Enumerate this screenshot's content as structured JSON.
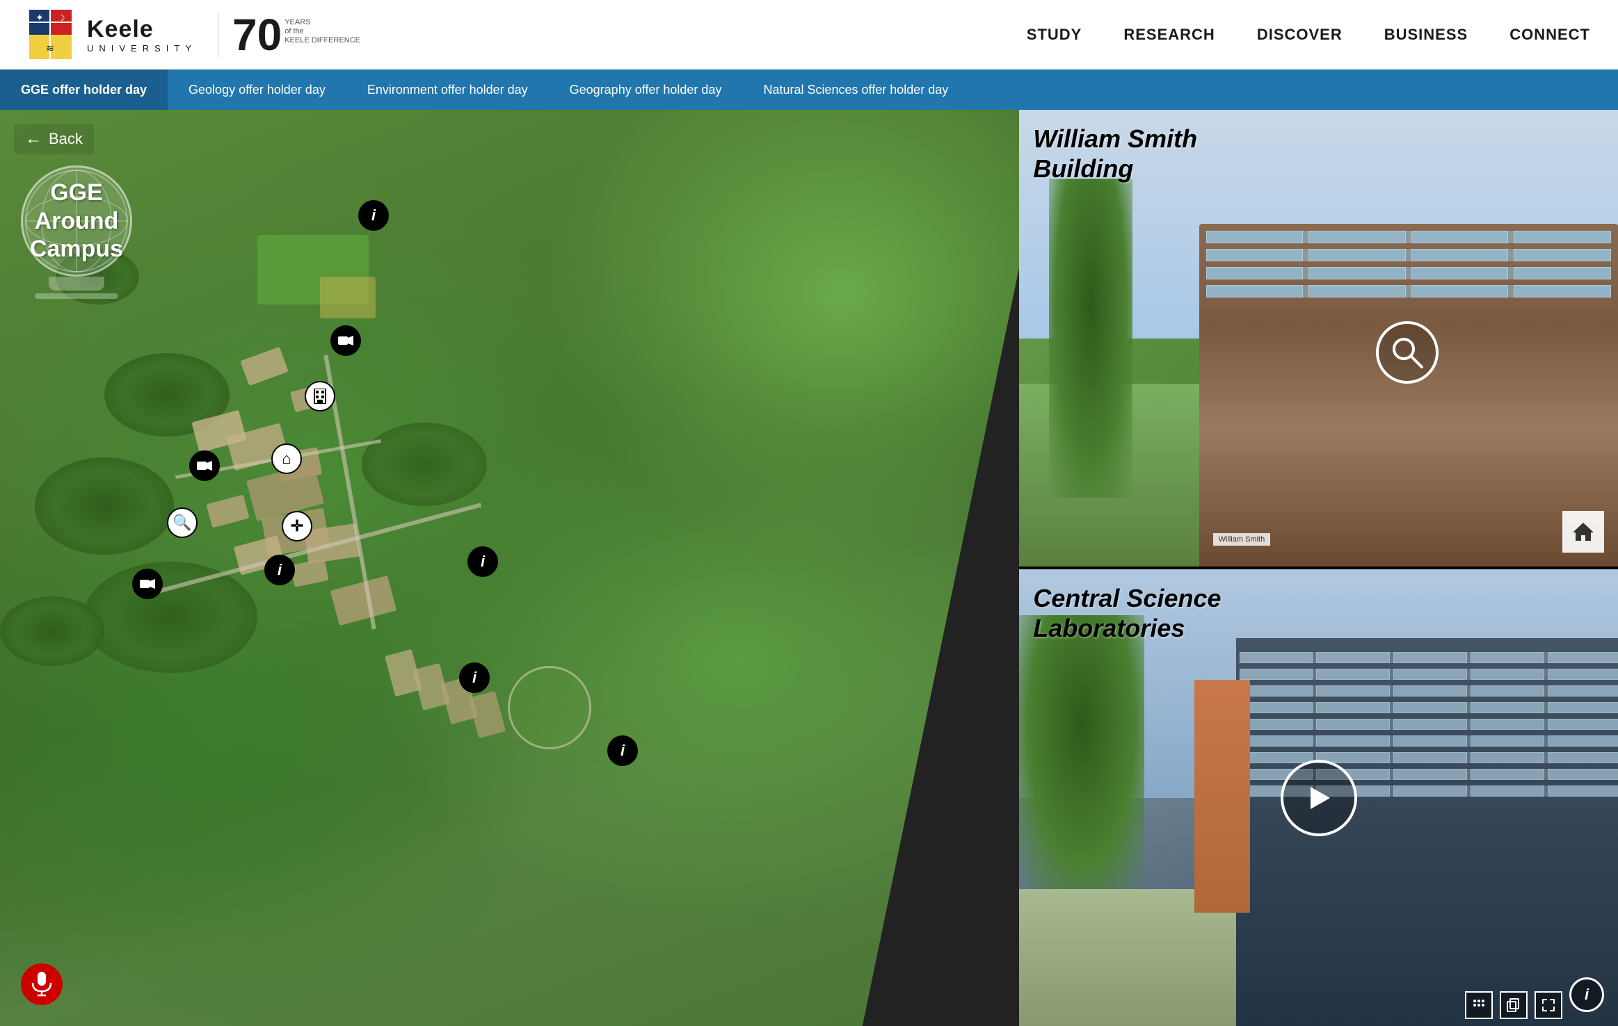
{
  "header": {
    "logo_main": "Keele",
    "logo_sub": "UNIVERSITY",
    "logo_years": "70",
    "logo_years_sub": "YEARS\nof the\nKEELE DIFFERENCE",
    "nav": [
      {
        "label": "STUDY",
        "id": "study"
      },
      {
        "label": "RESEARCH",
        "id": "research"
      },
      {
        "label": "DISCOVER",
        "id": "discover"
      },
      {
        "label": "BUSINESS",
        "id": "business"
      },
      {
        "label": "CONNECT",
        "id": "connect"
      }
    ]
  },
  "subnav": {
    "items": [
      {
        "label": "GGE offer holder day",
        "active": true
      },
      {
        "label": "Geology offer holder day",
        "active": false
      },
      {
        "label": "Environment offer holder day",
        "active": false
      },
      {
        "label": "Geography offer holder day",
        "active": false
      },
      {
        "label": "Natural Sciences offer holder day",
        "active": false
      }
    ]
  },
  "map": {
    "back_label": "Back",
    "globe_line1": "GGE",
    "globe_line2": "Around",
    "globe_line3": "Campus"
  },
  "panels": {
    "william_smith": {
      "title_line1": "William Smith",
      "title_line2": "Building"
    },
    "central_science": {
      "title_line1": "Central Science",
      "title_line2": "Laboratories"
    }
  },
  "icons": {
    "search": "🔍",
    "video": "▶",
    "info": "i",
    "home": "⌂",
    "move": "✛",
    "mic": "🎤",
    "camera": "📹"
  }
}
